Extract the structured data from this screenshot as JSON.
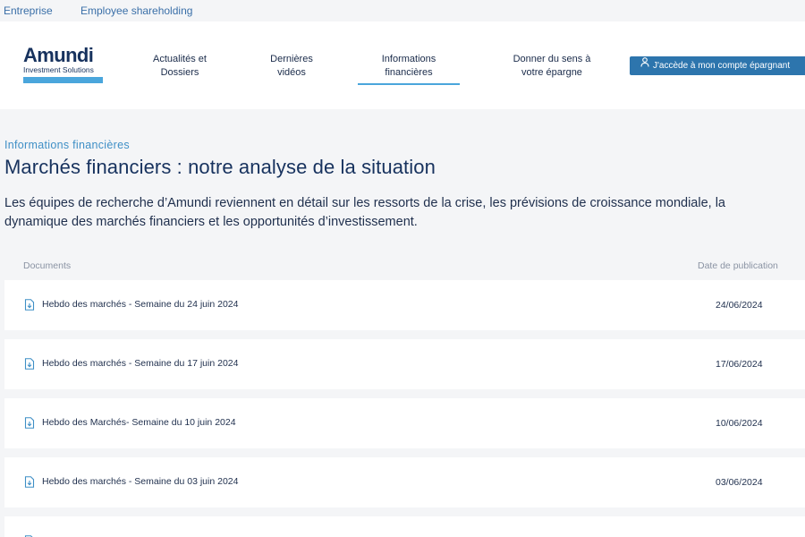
{
  "topbar": {
    "links": [
      "Entreprise",
      "Employee shareholding"
    ]
  },
  "logo": {
    "name": "Amundi",
    "tagline": "Investment Solutions",
    "brand_color": "#17325e",
    "accent_color": "#4aa6dc"
  },
  "nav": {
    "items": [
      {
        "line1": "Actualités et",
        "line2": "Dossiers"
      },
      {
        "line1": "Dernières",
        "line2": "vidéos"
      },
      {
        "line1": "Informations",
        "line2": "financières",
        "active": true
      },
      {
        "line1": "Donner du sens à",
        "line2": "votre épargne"
      }
    ],
    "cta_label": "J'accède à mon compte épargnant",
    "cta_icon": "user-icon",
    "cta_color": "#2d75ad"
  },
  "page": {
    "eyebrow": "Informations financières",
    "title": "Marchés financiers : notre analyse de la situation",
    "intro": "Les équipes de recherche d’Amundi reviennent en détail sur les ressorts de la crise, les prévisions de croissance mondiale, la dynamique des marchés financiers et les opportunités d’investissement."
  },
  "table": {
    "headers": {
      "documents": "Documents",
      "date": "Date de publication"
    },
    "rows": [
      {
        "title": "Hebdo des marchés - Semaine du 24 juin 2024",
        "date": "24/06/2024",
        "icon": "document-download-icon"
      },
      {
        "title": "Hebdo des marchés - Semaine du 17 juin 2024",
        "date": "17/06/2024",
        "icon": "document-download-icon"
      },
      {
        "title": " Hebdo des Marchés- Semaine du 10 juin 2024",
        "date": "10/06/2024",
        "icon": "document-download-icon"
      },
      {
        "title": "Hebdo des marchés - Semaine du 03 juin 2024",
        "date": "03/06/2024",
        "icon": "document-download-icon"
      }
    ]
  }
}
